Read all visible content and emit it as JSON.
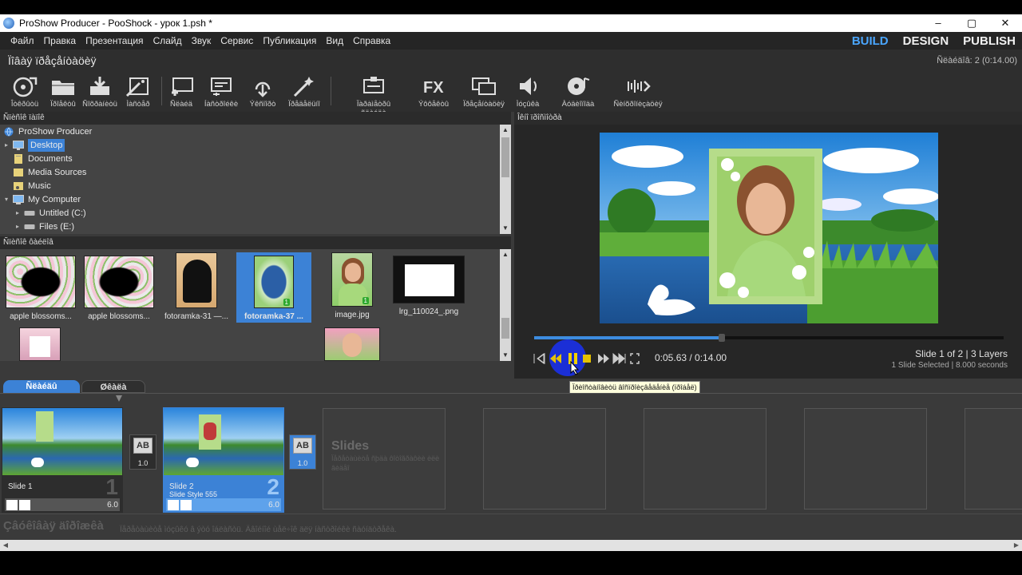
{
  "window": {
    "title": "ProShow Producer - PooShock - урок 1.psh *",
    "controls": {
      "minimize": "–",
      "maximize": "▢",
      "close": "✕"
    }
  },
  "menu": [
    "Файл",
    "Правка",
    "Презентация",
    "Слайд",
    "Звук",
    "Сервис",
    "Публикация",
    "Вид",
    "Справка"
  ],
  "modes": {
    "build": "BUILD",
    "design": "DESIGN",
    "publish": "PUBLISH",
    "active": "build"
  },
  "project": {
    "title": "Ïîâàÿ ïðåçåíòàöèÿ",
    "slides_count": "Ñëàéäîâ: 2 (0:14.00)"
  },
  "toolbar": [
    {
      "label": "Îòêðûòü",
      "icon": "open-show-icon"
    },
    {
      "label": "Ïðîåêòû",
      "icon": "folder-icon"
    },
    {
      "label": "Ñîõðàíèòü",
      "icon": "save-icon"
    },
    {
      "label": "Ìàñòåð",
      "icon": "wizard-icon"
    },
    {
      "label": "Ñëàéä",
      "icon": "new-slide-icon"
    },
    {
      "label": "Íàñòðîéêè",
      "icon": "slide-options-icon"
    },
    {
      "label": "Ýêñïîðò",
      "icon": "export-icon"
    },
    {
      "label": "Ïðåäåëüíî",
      "icon": "effects-wizard-icon"
    },
    {
      "label": "Ïàðàìåòðû ñëàéäà",
      "icon": "show-options-icon"
    },
    {
      "label": "Ýôôåêòû",
      "icon": "fx-icon"
    },
    {
      "label": "Ïðåçåíòàöèÿ",
      "icon": "presentation-icon"
    },
    {
      "label": "Ìóçûêà",
      "icon": "music-icon"
    },
    {
      "label": "Àóäèîïîäà",
      "icon": "audio-disc-icon"
    },
    {
      "label": "Ñèíõðîíèçàöèÿ",
      "icon": "sync-icon"
    }
  ],
  "folders_panel": {
    "header": "Ñïèñîê ïàïîê",
    "items": [
      {
        "label": "ProShow Producer",
        "icon": "globe-icon",
        "indent": 0
      },
      {
        "label": "Desktop",
        "icon": "desktop-icon",
        "indent": 1,
        "selected": true
      },
      {
        "label": "Documents",
        "icon": "documents-icon",
        "indent": 1
      },
      {
        "label": "Media Sources",
        "icon": "media-sources-icon",
        "indent": 1
      },
      {
        "label": "Music",
        "icon": "music-folder-icon",
        "indent": 1
      },
      {
        "label": "My Computer",
        "icon": "computer-icon",
        "indent": 1
      },
      {
        "label": "Untitled (C:)",
        "icon": "drive-icon",
        "indent": 2
      },
      {
        "label": "Files (E:)",
        "icon": "drive-icon",
        "indent": 2
      }
    ]
  },
  "files_panel": {
    "header": "Ñïèñîê ôàéëîâ",
    "files": [
      {
        "name": "apple blossoms...",
        "badge": ""
      },
      {
        "name": "apple blossoms...",
        "badge": ""
      },
      {
        "name": "fotoramka-31 —...",
        "badge": ""
      },
      {
        "name": "fotoramka-37 ...",
        "badge": "1",
        "selected": true
      },
      {
        "name": "image.jpg",
        "badge": "1"
      },
      {
        "name": "lrg_110024_.png",
        "badge": ""
      }
    ]
  },
  "preview": {
    "header": "Îêíî ïðîñìîòðà",
    "time": "0:05.63 / 0:14.00",
    "progress": 0.4,
    "slide_info": "Slide 1 of 2  |  3 Layers",
    "slide_sub": "1 Slide Selected  |  8.000 seconds",
    "tooltip": "Ïðèîñòàíîâèòü âîñïðîèçâåäåíèå (ïðîáåë)"
  },
  "tabs": {
    "slides": "Ñëàéäû",
    "timeline": "Øêàëà"
  },
  "timeline": {
    "slides": [
      {
        "name": "Slide 1",
        "style": "",
        "number": "1",
        "duration": "6.0"
      },
      {
        "name": "Slide 2",
        "style": "Slide Style  555",
        "number": "2",
        "duration": "6.0",
        "selected": true
      }
    ],
    "transitions": [
      {
        "label": "AB",
        "duration": "1.0"
      },
      {
        "label": "AB",
        "duration": "1.0",
        "selected": true
      }
    ],
    "placeholder_title": "Slides",
    "placeholder_text": "Ïåðåòàùèòå ñþäà ôîòîãðàôèè èëè âèäåî",
    "soundtrack": "Çâóêîâàÿ äîðîæêà",
    "soundtrack_hint": "Ïåðåòàùèòå ìóçûêó â ýòó îáëàñòü. Äâîéíîé ùåë÷îê äëÿ íàñòðîéêè ñàóíäòðåêà."
  }
}
